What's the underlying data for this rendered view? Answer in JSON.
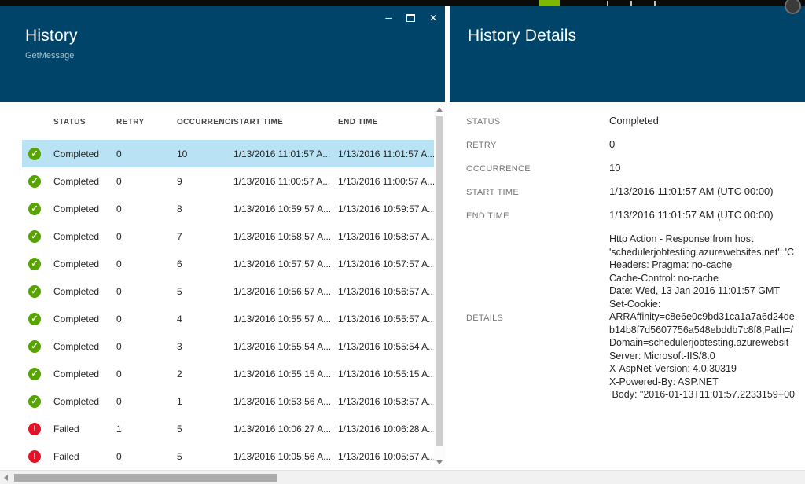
{
  "icons": {
    "check": "✓",
    "error": "!",
    "minimize": "─",
    "close": "✕"
  },
  "colors": {
    "header": "#004569",
    "selected_row": "#b9e3f4",
    "success": "#57a300",
    "error": "#e81123",
    "top_accent": "#7eb900"
  },
  "history_blade": {
    "title": "History",
    "subtitle": "GetMessage",
    "columns": [
      "STATUS",
      "RETRY",
      "OCCURRENCE",
      "START TIME",
      "END TIME"
    ],
    "rows": [
      {
        "state": "ok",
        "selected": true,
        "status": "Completed",
        "retry": "0",
        "occurrence": "10",
        "start_time": "1/13/2016 11:01:57 A...",
        "end_time": "1/13/2016 11:01:57 A..."
      },
      {
        "state": "ok",
        "selected": false,
        "status": "Completed",
        "retry": "0",
        "occurrence": "9",
        "start_time": "1/13/2016 11:00:57 A...",
        "end_time": "1/13/2016 11:00:57 A..."
      },
      {
        "state": "ok",
        "selected": false,
        "status": "Completed",
        "retry": "0",
        "occurrence": "8",
        "start_time": "1/13/2016 10:59:57 A...",
        "end_time": "1/13/2016 10:59:57 A..."
      },
      {
        "state": "ok",
        "selected": false,
        "status": "Completed",
        "retry": "0",
        "occurrence": "7",
        "start_time": "1/13/2016 10:58:57 A...",
        "end_time": "1/13/2016 10:58:57 A..."
      },
      {
        "state": "ok",
        "selected": false,
        "status": "Completed",
        "retry": "0",
        "occurrence": "6",
        "start_time": "1/13/2016 10:57:57 A...",
        "end_time": "1/13/2016 10:57:57 A..."
      },
      {
        "state": "ok",
        "selected": false,
        "status": "Completed",
        "retry": "0",
        "occurrence": "5",
        "start_time": "1/13/2016 10:56:57 A...",
        "end_time": "1/13/2016 10:56:57 A..."
      },
      {
        "state": "ok",
        "selected": false,
        "status": "Completed",
        "retry": "0",
        "occurrence": "4",
        "start_time": "1/13/2016 10:55:57 A...",
        "end_time": "1/13/2016 10:55:57 A..."
      },
      {
        "state": "ok",
        "selected": false,
        "status": "Completed",
        "retry": "0",
        "occurrence": "3",
        "start_time": "1/13/2016 10:55:54 A...",
        "end_time": "1/13/2016 10:55:54 A..."
      },
      {
        "state": "ok",
        "selected": false,
        "status": "Completed",
        "retry": "0",
        "occurrence": "2",
        "start_time": "1/13/2016 10:55:15 A...",
        "end_time": "1/13/2016 10:55:15 A..."
      },
      {
        "state": "ok",
        "selected": false,
        "status": "Completed",
        "retry": "0",
        "occurrence": "1",
        "start_time": "1/13/2016 10:53:56 A...",
        "end_time": "1/13/2016 10:53:57 A..."
      },
      {
        "state": "error",
        "selected": false,
        "status": "Failed",
        "retry": "1",
        "occurrence": "5",
        "start_time": "1/13/2016 10:06:27 A...",
        "end_time": "1/13/2016 10:06:28 A..."
      },
      {
        "state": "error",
        "selected": false,
        "status": "Failed",
        "retry": "0",
        "occurrence": "5",
        "start_time": "1/13/2016 10:05:56 A...",
        "end_time": "1/13/2016 10:05:57 A..."
      }
    ]
  },
  "details_blade": {
    "title": "History Details",
    "fields": [
      {
        "label": "STATUS",
        "value": "Completed"
      },
      {
        "label": "RETRY",
        "value": "0"
      },
      {
        "label": "OCCURRENCE",
        "value": "10"
      },
      {
        "label": "START TIME",
        "value": "1/13/2016 11:01:57 AM (UTC 00:00)"
      },
      {
        "label": "END TIME",
        "value": "1/13/2016 11:01:57 AM (UTC 00:00)"
      }
    ],
    "details_label": "DETAILS",
    "details_lines": [
      "Http Action - Response from host",
      "'schedulerjobtesting.azurewebsites.net': 'C",
      "Headers: Pragma: no-cache",
      "Cache-Control: no-cache",
      "Date: Wed, 13 Jan 2016 11:01:57 GMT",
      "Set-Cookie:",
      "ARRAffinity=c8e6e0c9bd31ca1a7a6d24de",
      "b14b8f7d5607756a548ebddb7c8f8;Path=/",
      "Domain=schedulerjobtesting.azurewebsit",
      "Server: Microsoft-IIS/8.0",
      "X-AspNet-Version: 4.0.30319",
      "X-Powered-By: ASP.NET",
      " Body: \"2016-01-13T11:01:57.2233159+00"
    ]
  }
}
